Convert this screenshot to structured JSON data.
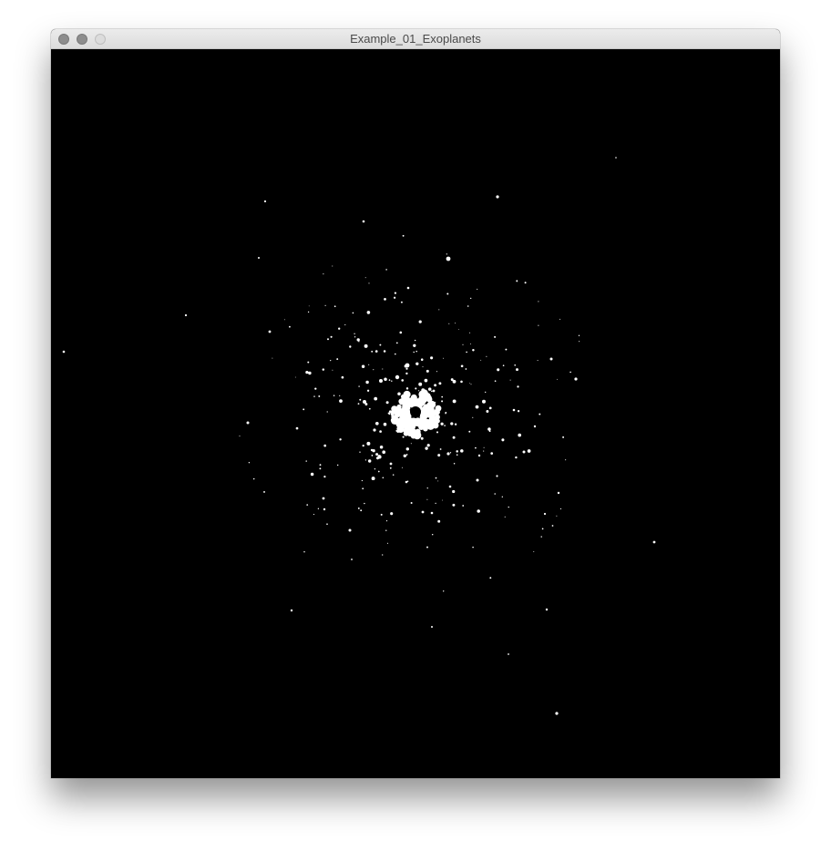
{
  "window": {
    "title": "Example_01_Exoplanets",
    "canvas_background": "#000000",
    "planet_color": "#ffffff"
  },
  "controls": {
    "close": "close-icon",
    "minimize": "minimize-icon",
    "zoom": "zoom-icon"
  }
}
